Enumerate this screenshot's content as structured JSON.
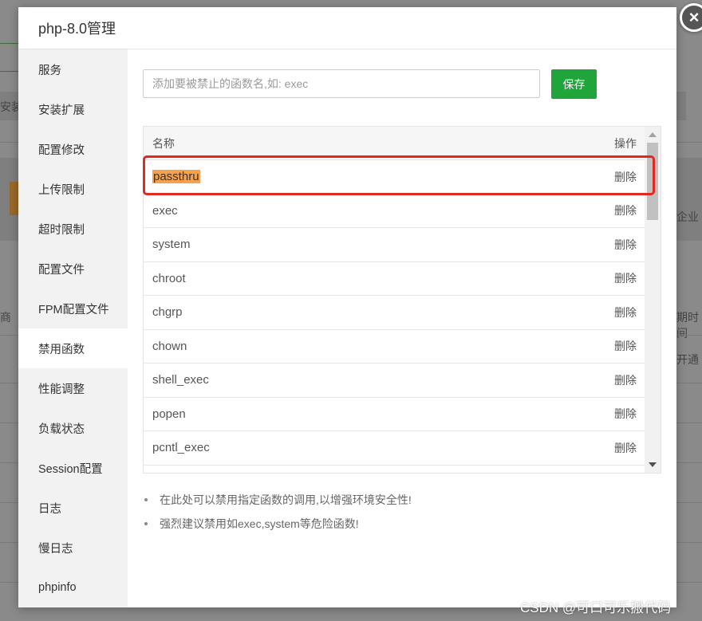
{
  "window": {
    "title": "php-8.0管理",
    "close_glyph": "×"
  },
  "background": {
    "fragments": [
      "安装",
      "企业",
      "商",
      "期时间",
      "开通"
    ]
  },
  "sidebar": {
    "items": [
      {
        "label": "服务"
      },
      {
        "label": "安装扩展"
      },
      {
        "label": "配置修改"
      },
      {
        "label": "上传限制"
      },
      {
        "label": "超时限制"
      },
      {
        "label": "配置文件"
      },
      {
        "label": "FPM配置文件"
      },
      {
        "label": "禁用函数",
        "active": true
      },
      {
        "label": "性能调整"
      },
      {
        "label": "负载状态"
      },
      {
        "label": "Session配置"
      },
      {
        "label": "日志"
      },
      {
        "label": "慢日志"
      },
      {
        "label": "phpinfo"
      }
    ]
  },
  "form": {
    "placeholder": "添加要被禁止的函数名,如: exec",
    "value": "",
    "save_label": "保存"
  },
  "table": {
    "headers": {
      "name": "名称",
      "action": "操作"
    },
    "rows": [
      {
        "name": "passthru",
        "action": "删除",
        "highlighted": true
      },
      {
        "name": "exec",
        "action": "删除"
      },
      {
        "name": "system",
        "action": "删除"
      },
      {
        "name": "chroot",
        "action": "删除"
      },
      {
        "name": "chgrp",
        "action": "删除"
      },
      {
        "name": "chown",
        "action": "删除"
      },
      {
        "name": "shell_exec",
        "action": "删除"
      },
      {
        "name": "popen",
        "action": "删除"
      },
      {
        "name": "pcntl_exec",
        "action": "删除"
      }
    ]
  },
  "tips": [
    "在此处可以禁用指定函数的调用,以增强环境安全性!",
    "强烈建议禁用如exec,system等危险函数!"
  ],
  "watermark": "CSDN @可口可乐搬代码",
  "colors": {
    "accent_green": "#20a53a",
    "highlight_orange": "#f7a14a",
    "annotation_red": "#e5281f"
  }
}
